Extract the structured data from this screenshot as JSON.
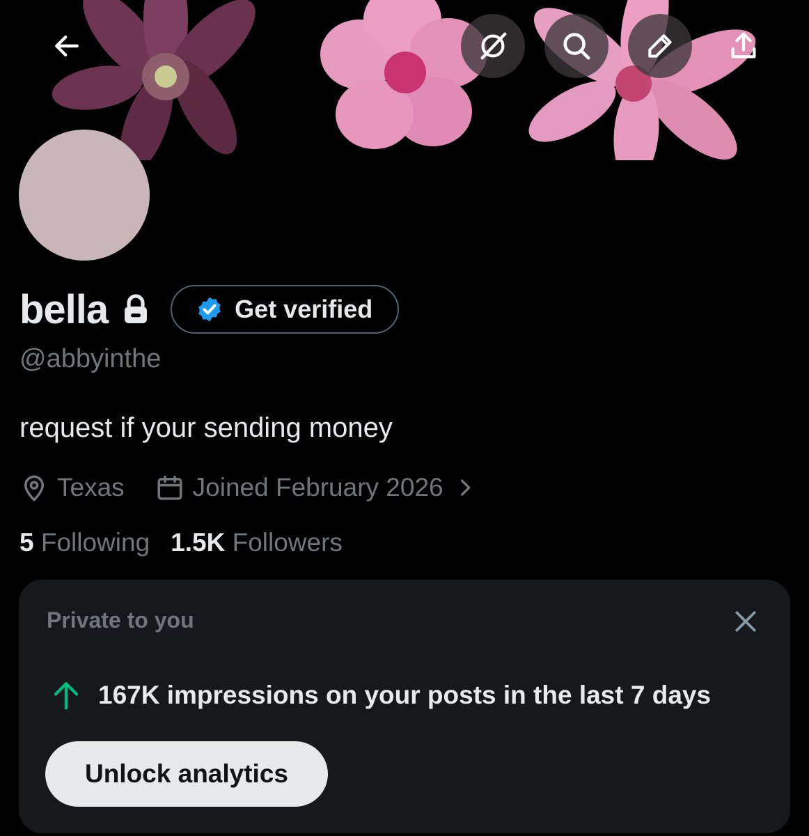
{
  "header": {
    "icons": [
      "back-arrow-icon",
      "grok-icon",
      "search-icon",
      "edit-pencil-icon",
      "share-icon"
    ]
  },
  "profile": {
    "name": "bella",
    "handle": "@abbyinthe",
    "get_verified_label": "Get verified",
    "bio": "request if your sending money",
    "location": "Texas",
    "joined": "Joined February 2026",
    "following_count": "5",
    "following_label": "Following",
    "followers_count": "1.5K",
    "followers_label": "Followers"
  },
  "private_card": {
    "title": "Private to you",
    "impressions_text": "167K impressions on your posts in the last 7 days",
    "unlock_label": "Unlock analytics"
  },
  "colors": {
    "background": "#000000",
    "card_background": "#16181c",
    "muted_text": "#71767b",
    "primary_text": "#e7e9ea",
    "verified_blue": "#1d9bf0",
    "trend_green": "#00ba7c",
    "avatar_fill": "#c9b6b9"
  }
}
